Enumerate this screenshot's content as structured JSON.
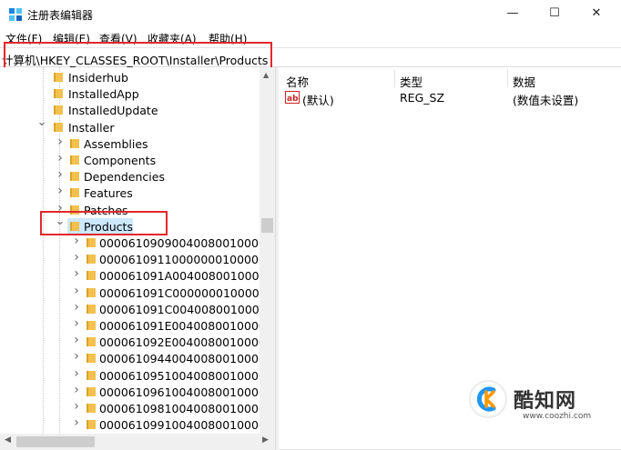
{
  "window": {
    "title": "注册表编辑器",
    "accent": "#0078d7",
    "controls": {
      "minimize": "—",
      "maximize": "☐",
      "close": "✕"
    }
  },
  "menu": [
    "文件(F)",
    "编辑(E)",
    "查看(V)",
    "收藏夹(A)",
    "帮助(H)"
  ],
  "address": {
    "path": "计算机\\HKEY_CLASSES_ROOT\\Installer\\Products"
  },
  "tree": {
    "items": [
      {
        "label": "Insiderhub",
        "depth": 0,
        "chevron": "",
        "selected": false
      },
      {
        "label": "InstalledApp",
        "depth": 0,
        "chevron": "",
        "selected": false
      },
      {
        "label": "InstalledUpdate",
        "depth": 0,
        "chevron": "",
        "selected": false
      },
      {
        "label": "Installer",
        "depth": 0,
        "chevron": "v",
        "selected": false
      },
      {
        "label": "Assemblies",
        "depth": 1,
        "chevron": ">",
        "selected": false
      },
      {
        "label": "Components",
        "depth": 1,
        "chevron": ">",
        "selected": false
      },
      {
        "label": "Dependencies",
        "depth": 1,
        "chevron": ">",
        "selected": false
      },
      {
        "label": "Features",
        "depth": 1,
        "chevron": ">",
        "selected": false
      },
      {
        "label": "Patches",
        "depth": 1,
        "chevron": ">",
        "selected": false
      },
      {
        "label": "Products",
        "depth": 1,
        "chevron": "v",
        "selected": true
      },
      {
        "label": "00006109090040080010000",
        "depth": 2,
        "chevron": ">",
        "selected": false
      },
      {
        "label": "00006109110000000100000",
        "depth": 2,
        "chevron": ">",
        "selected": false
      },
      {
        "label": "000061091A0040080010000",
        "depth": 2,
        "chevron": ">",
        "selected": false
      },
      {
        "label": "000061091C0000000100000",
        "depth": 2,
        "chevron": ">",
        "selected": false
      },
      {
        "label": "000061091C0040080010000",
        "depth": 2,
        "chevron": ">",
        "selected": false
      },
      {
        "label": "000061091E0040080010000",
        "depth": 2,
        "chevron": ">",
        "selected": false
      },
      {
        "label": "000061092E0040080010000",
        "depth": 2,
        "chevron": ">",
        "selected": false
      },
      {
        "label": "00006109440040080010000",
        "depth": 2,
        "chevron": ">",
        "selected": false
      },
      {
        "label": "00006109510040080010000",
        "depth": 2,
        "chevron": ">",
        "selected": false
      },
      {
        "label": "00006109610040080010000",
        "depth": 2,
        "chevron": ">",
        "selected": false
      },
      {
        "label": "00006109810040080010000",
        "depth": 2,
        "chevron": ">",
        "selected": false
      },
      {
        "label": "00006109910040080010000",
        "depth": 2,
        "chevron": ">",
        "selected": false
      }
    ]
  },
  "list": {
    "headers": {
      "name": "名称",
      "type": "类型",
      "data": "数据"
    },
    "rows": [
      {
        "icon": "ab-string-icon",
        "name": "(默认)",
        "type": "REG_SZ",
        "data": "(数值未设置)"
      }
    ]
  },
  "watermark": {
    "text": "酷知网",
    "url": "www.coozhi.com"
  },
  "colors": {
    "highlight": "#e2272b",
    "selection": "#cce8ff",
    "folder": "#f2c14e"
  }
}
